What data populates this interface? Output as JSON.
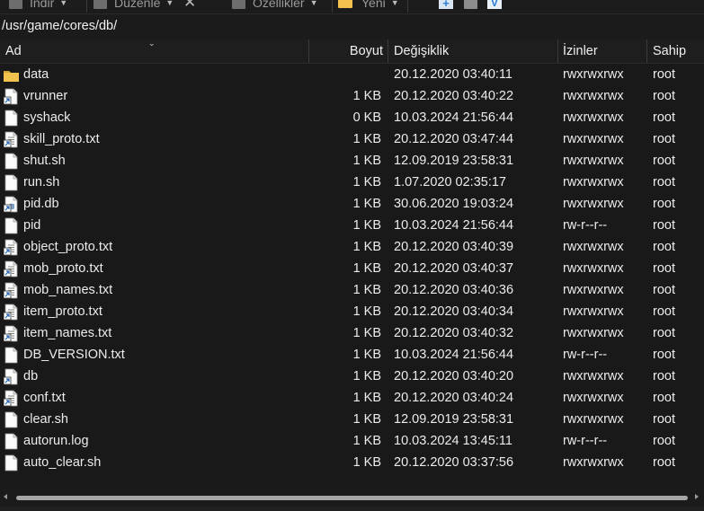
{
  "toolbar": {
    "download_label": "İndir",
    "edit_label": "Düzenle",
    "properties_label": "Özellikler",
    "new_label": "Yeni"
  },
  "path": "/usr/game/cores/db/",
  "columns": {
    "name": "Ad",
    "size": "Boyut",
    "modified": "Değişiklik",
    "permissions": "İzinler",
    "owner": "Sahip"
  },
  "files": [
    {
      "name": "data",
      "size": "",
      "modified": "20.12.2020 03:40:11",
      "permissions": "rwxrwxrwx",
      "owner": "root",
      "icon": "folder-icon"
    },
    {
      "name": "vrunner",
      "size": "1 KB",
      "modified": "20.12.2020 03:40:22",
      "permissions": "rwxrwxrwx",
      "owner": "root",
      "icon": "symlink-file-icon"
    },
    {
      "name": "syshack",
      "size": "0 KB",
      "modified": "10.03.2024 21:56:44",
      "permissions": "rwxrwxrwx",
      "owner": "root",
      "icon": "file-icon"
    },
    {
      "name": "skill_proto.txt",
      "size": "1 KB",
      "modified": "20.12.2020 03:47:44",
      "permissions": "rwxrwxrwx",
      "owner": "root",
      "icon": "symlink-text-file-icon"
    },
    {
      "name": "shut.sh",
      "size": "1 KB",
      "modified": "12.09.2019 23:58:31",
      "permissions": "rwxrwxrwx",
      "owner": "root",
      "icon": "file-icon"
    },
    {
      "name": "run.sh",
      "size": "1 KB",
      "modified": "1.07.2020 02:35:17",
      "permissions": "rwxrwxrwx",
      "owner": "root",
      "icon": "file-icon"
    },
    {
      "name": "pid.db",
      "size": "1 KB",
      "modified": "30.06.2020 19:03:24",
      "permissions": "rwxrwxrwx",
      "owner": "root",
      "icon": "database-file-icon"
    },
    {
      "name": "pid",
      "size": "1 KB",
      "modified": "10.03.2024 21:56:44",
      "permissions": "rw-r--r--",
      "owner": "root",
      "icon": "file-icon"
    },
    {
      "name": "object_proto.txt",
      "size": "1 KB",
      "modified": "20.12.2020 03:40:39",
      "permissions": "rwxrwxrwx",
      "owner": "root",
      "icon": "symlink-text-file-icon"
    },
    {
      "name": "mob_proto.txt",
      "size": "1 KB",
      "modified": "20.12.2020 03:40:37",
      "permissions": "rwxrwxrwx",
      "owner": "root",
      "icon": "symlink-text-file-icon"
    },
    {
      "name": "mob_names.txt",
      "size": "1 KB",
      "modified": "20.12.2020 03:40:36",
      "permissions": "rwxrwxrwx",
      "owner": "root",
      "icon": "symlink-text-file-icon"
    },
    {
      "name": "item_proto.txt",
      "size": "1 KB",
      "modified": "20.12.2020 03:40:34",
      "permissions": "rwxrwxrwx",
      "owner": "root",
      "icon": "symlink-text-file-icon"
    },
    {
      "name": "item_names.txt",
      "size": "1 KB",
      "modified": "20.12.2020 03:40:32",
      "permissions": "rwxrwxrwx",
      "owner": "root",
      "icon": "symlink-text-file-icon"
    },
    {
      "name": "DB_VERSION.txt",
      "size": "1 KB",
      "modified": "10.03.2024 21:56:44",
      "permissions": "rw-r--r--",
      "owner": "root",
      "icon": "file-icon"
    },
    {
      "name": "db",
      "size": "1 KB",
      "modified": "20.12.2020 03:40:20",
      "permissions": "rwxrwxrwx",
      "owner": "root",
      "icon": "symlink-file-icon"
    },
    {
      "name": "conf.txt",
      "size": "1 KB",
      "modified": "20.12.2020 03:40:24",
      "permissions": "rwxrwxrwx",
      "owner": "root",
      "icon": "symlink-text-file-icon"
    },
    {
      "name": "clear.sh",
      "size": "1 KB",
      "modified": "12.09.2019 23:58:31",
      "permissions": "rwxrwxrwx",
      "owner": "root",
      "icon": "file-icon"
    },
    {
      "name": "autorun.log",
      "size": "1 KB",
      "modified": "10.03.2024 13:45:11",
      "permissions": "rw-r--r--",
      "owner": "root",
      "icon": "file-icon"
    },
    {
      "name": "auto_clear.sh",
      "size": "1 KB",
      "modified": "20.12.2020 03:37:56",
      "permissions": "rwxrwxrwx",
      "owner": "root",
      "icon": "file-icon"
    }
  ],
  "colors": {
    "background": "#191919",
    "text": "#ececec",
    "folder": "#f2c14e",
    "accent_blue": "#4aa3e6"
  }
}
